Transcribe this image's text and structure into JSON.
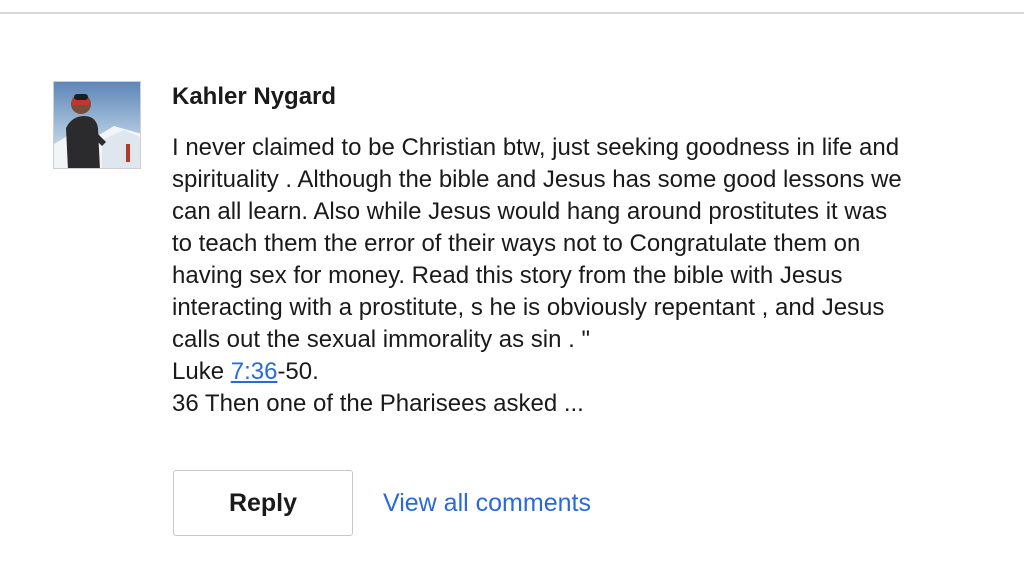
{
  "comment": {
    "author": "Kahler Nygard",
    "avatar_icon": "user-avatar-photo",
    "lines": [
      "I never claimed to be Christian btw, just seeking goodness in life and",
      "spirituality . Although the bible and Jesus has some good lessons we",
      "can all learn. Also while Jesus would hang around prostitutes it was",
      "to teach them the error of their ways not to Congratulate them on",
      "having sex for money. Read this story from the bible with Jesus",
      "interacting with a prostitute, s he is obviously repentant , and Jesus",
      "calls out the sexual immorality as sin . \""
    ],
    "verse": {
      "prefix": "Luke ",
      "link": "7:36",
      "suffix": "-50."
    },
    "last_line": "36 Then one of the Pharisees asked ..."
  },
  "actions": {
    "reply_label": "Reply",
    "view_all_label": "View all comments"
  },
  "colors": {
    "link": "#2a6ad8",
    "border": "#c8c8c8"
  }
}
